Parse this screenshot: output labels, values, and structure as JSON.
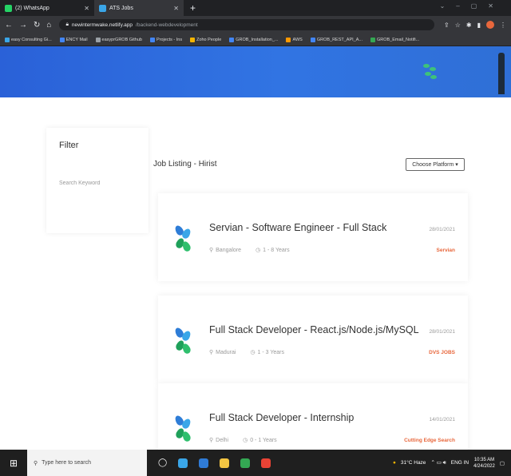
{
  "browser": {
    "tabs": [
      {
        "label": "(2) WhatsApp",
        "color": "#25d366"
      },
      {
        "label": "ATS Jobs",
        "color": "#3aa6e8"
      }
    ],
    "new_tab": "+",
    "url_host": "newintermwake.netlify.app",
    "url_path": "/backend-webdevelopment",
    "bookmarks": [
      {
        "label": "easy Consulting Gi...",
        "color": "#3aa6e8"
      },
      {
        "label": "ENCY Mail",
        "color": "#4285f4"
      },
      {
        "label": "easyprGROB Github",
        "color": "#9aa0a6"
      },
      {
        "label": "Projects - Ins",
        "color": "#4285f4"
      },
      {
        "label": "Zoho People",
        "color": "#f4b400"
      },
      {
        "label": "GROB_Installation_...",
        "color": "#4285f4"
      },
      {
        "label": "AWS",
        "color": "#ff9900"
      },
      {
        "label": "GROB_REST_API_A...",
        "color": "#4285f4"
      },
      {
        "label": "GROB_Email_Notifi...",
        "color": "#34a853"
      }
    ]
  },
  "filter": {
    "title": "Filter",
    "search_placeholder": "Search Keyword"
  },
  "listing": {
    "title": "Job Listing - Hirist",
    "platform_button": "Choose Platform ▾"
  },
  "jobs": [
    {
      "title": "Servian - Software Engineer - Full Stack",
      "location": "Bangalore",
      "experience": "1 - 8 Years",
      "date": "28/01/2021",
      "company": "Servian"
    },
    {
      "title": "Full Stack Developer - React.js/Node.js/MySQL",
      "location": "Madurai",
      "experience": "1 - 3 Years",
      "date": "28/01/2021",
      "company": "DVS JOBS"
    },
    {
      "title": "Full Stack Developer - Internship",
      "location": "Delhi",
      "experience": "0 - 1 Years",
      "date": "14/01/2021",
      "company": "Cutting Edge Search"
    }
  ],
  "taskbar": {
    "search_placeholder": "Type here to search",
    "weather": "31°C Haze",
    "lang": "ENG IN",
    "time": "10:35 AM",
    "date": "4/24/2022"
  },
  "colors": {
    "hero_blue": "#3174e3",
    "company_orange": "#e8673c"
  }
}
